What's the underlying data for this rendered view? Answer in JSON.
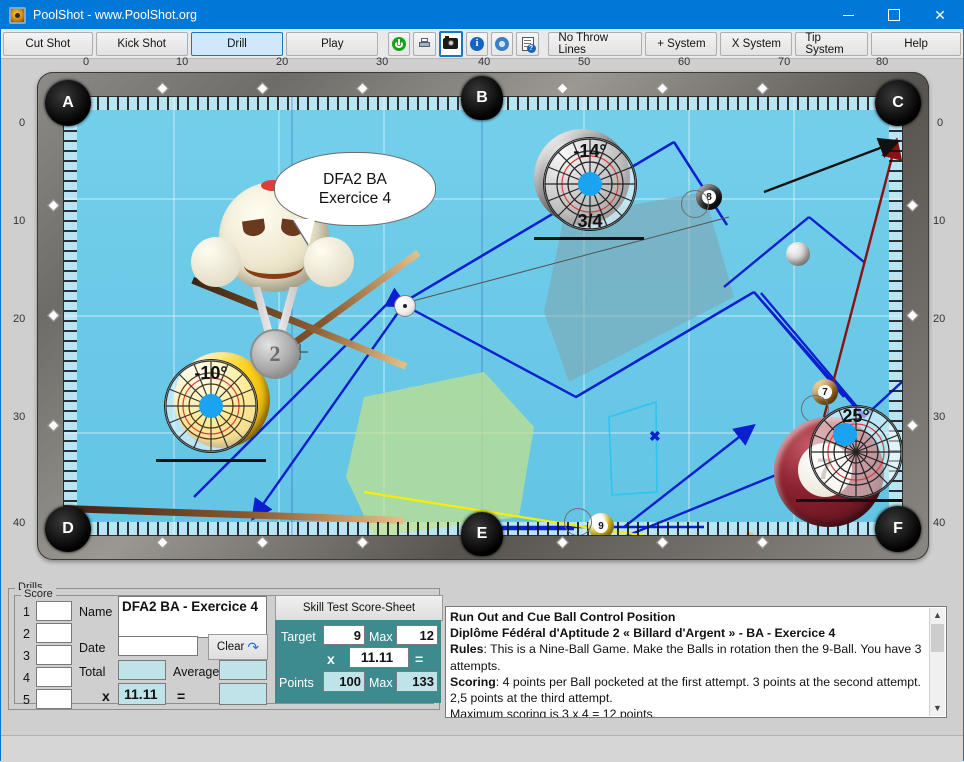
{
  "window": {
    "title": "PoolShot - www.PoolShot.org",
    "app_icon": "poolshot-logo-icon",
    "minimize": "minimize-icon",
    "maximize": "maximize-icon",
    "close": "close-icon"
  },
  "toolbar": {
    "modes": [
      {
        "label": "Cut Shot",
        "active": false
      },
      {
        "label": "Kick Shot",
        "active": false
      },
      {
        "label": "Drill",
        "active": true
      },
      {
        "label": "Play",
        "active": false
      }
    ],
    "icons": [
      {
        "name": "power-icon",
        "selected": false
      },
      {
        "name": "printer-icon",
        "selected": false
      },
      {
        "name": "camera-icon",
        "selected": true
      },
      {
        "name": "info-icon",
        "glyph": "i",
        "selected": false
      },
      {
        "name": "gear-icon",
        "selected": false
      },
      {
        "name": "document-help-icon",
        "glyph": "?",
        "selected": false
      }
    ],
    "systems": [
      {
        "label": "No Throw Lines"
      },
      {
        "label": "+ System"
      },
      {
        "label": "X System"
      },
      {
        "label": "Tip System"
      }
    ],
    "help": "Help"
  },
  "table": {
    "top_ruler": [
      "0",
      "10",
      "20",
      "30",
      "40",
      "50",
      "60",
      "70",
      "80"
    ],
    "left_ruler": [
      "0",
      "10",
      "20",
      "30",
      "40"
    ],
    "right_ruler": [
      "0",
      "10",
      "20",
      "30",
      "40"
    ],
    "pockets": [
      "A",
      "B",
      "C",
      "D",
      "E",
      "F"
    ],
    "speech_bubble": {
      "line1": "DFA2 BA",
      "line2": "Exercice 4"
    },
    "mascot": {
      "medal": "2"
    },
    "spinners": [
      {
        "name": "spin-indicator-cueball-top",
        "degrees": "-14°",
        "fraction": "3/4"
      },
      {
        "name": "spin-indicator-yellow-ball",
        "degrees": "-10°",
        "fraction": ""
      },
      {
        "name": "spin-indicator-red-ball",
        "degrees": "25°",
        "fraction": ""
      }
    ],
    "balls": [
      {
        "number": "8",
        "color": "#1a1a1a"
      },
      {
        "number": "7",
        "color": "#b4761c"
      },
      {
        "number": "9",
        "color": "#e8c413"
      },
      {
        "number": "7",
        "color": "#7d1d28"
      }
    ],
    "colors": {
      "felt": "#6fcbe8",
      "rail": "#7b7873",
      "line_primary": "#0b1fd0",
      "line_yellow": "#f5f000",
      "line_red": "#8b1111",
      "line_black": "#111111",
      "cone_green": "#c4e08a",
      "cone_gray": "#7fa3ad",
      "rack_outline": "#2ec4f0"
    }
  },
  "bottom": {
    "drills_group_label": "Drills",
    "score_group_label": "Score",
    "score_rows": [
      "1",
      "2",
      "3",
      "4",
      "5"
    ],
    "score_values": [
      "",
      "",
      "",
      "",
      ""
    ],
    "fields": {
      "name_label": "Name",
      "name_value": "DFA2 BA - Exercice 4",
      "date_label": "Date",
      "date_value": "",
      "total_label": "Total",
      "total_value": "",
      "average_label": "Average",
      "average_value": "",
      "multiply_symbol": "x",
      "multiplier_value": "11.11",
      "equals_symbol": "=",
      "result_value": "",
      "clear_label": "Clear",
      "clear_icon": "undo-arrow-icon"
    },
    "scoresheet": {
      "header": "Skill Test Score-Sheet",
      "target_label": "Target",
      "target_value": "9",
      "target_max_label": "Max",
      "target_max_value": "12",
      "multiply_symbol": "x",
      "multiplier_value": "11.11",
      "equals_symbol": "=",
      "points_label": "Points",
      "points_value": "100",
      "points_max_label": "Max",
      "points_max_value": "133"
    },
    "description": {
      "title1": "Run Out and Cue Ball Control Position",
      "title2": "Diplôme Fédéral d'Aptitude 2 « Billard d'Argent » - BA - Exercice 4",
      "rules_label": "Rules",
      "rules_text": ": This is a Nine-Ball Game. Make the Balls in rotation then the 9-Ball. You have 3 attempts.",
      "scoring_label": "Scoring",
      "scoring_text": ": 4 points per Ball pocketed at the first attempt. 3 points at the second attempt. 2,5 points at the third attempt.",
      "max_text": "Maximum scoring is 3 x 4 = 12 points.",
      "scroll_up": "▲",
      "scroll_down": "▼"
    }
  }
}
